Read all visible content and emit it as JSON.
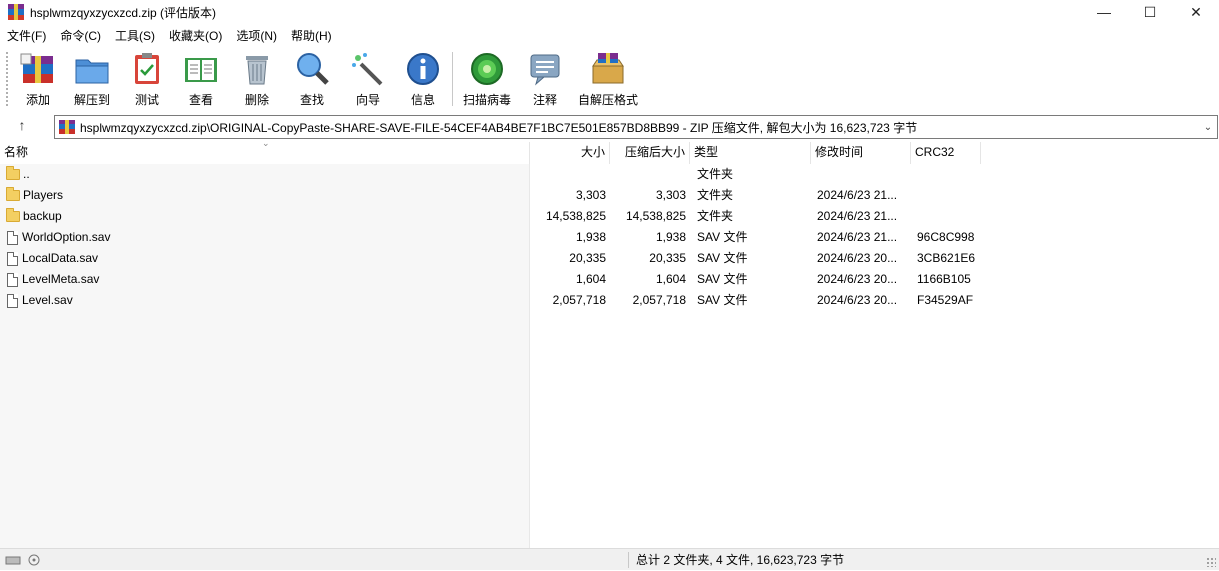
{
  "window": {
    "title": "hsplwmzqyxzycxzcd.zip (评估版本)",
    "minimize": "—",
    "maximize": "☐",
    "close": "✕"
  },
  "menu": [
    "文件(F)",
    "命令(C)",
    "工具(S)",
    "收藏夹(O)",
    "选项(N)",
    "帮助(H)"
  ],
  "toolbar": {
    "add": "添加",
    "extract": "解压到",
    "test": "测试",
    "view": "查看",
    "delete": "删除",
    "find": "查找",
    "wizard": "向导",
    "info": "信息",
    "virus": "扫描病毒",
    "comment": "注释",
    "sfx": "自解压格式"
  },
  "address": {
    "up": "↑",
    "path": "hsplwmzqyxzycxzcd.zip\\ORIGINAL-CopyPaste-SHARE-SAVE-FILE-54CEF4AB4BE7F1BC7E501E857BD8BB99 - ZIP 压缩文件, 解包大小为 16,623,723 字节",
    "dropdown": "⌄"
  },
  "columns": {
    "name": "名称",
    "size": "大小",
    "packed": "压缩后大小",
    "type": "类型",
    "modified": "修改时间",
    "crc": "CRC32"
  },
  "files": [
    {
      "name": "..",
      "size": "",
      "packed": "",
      "type": "文件夹",
      "modified": "",
      "crc": "",
      "kind": "folder"
    },
    {
      "name": "Players",
      "size": "3,303",
      "packed": "3,303",
      "type": "文件夹",
      "modified": "2024/6/23 21...",
      "crc": "",
      "kind": "folder"
    },
    {
      "name": "backup",
      "size": "14,538,825",
      "packed": "14,538,825",
      "type": "文件夹",
      "modified": "2024/6/23 21...",
      "crc": "",
      "kind": "folder"
    },
    {
      "name": "WorldOption.sav",
      "size": "1,938",
      "packed": "1,938",
      "type": "SAV 文件",
      "modified": "2024/6/23 21...",
      "crc": "96C8C998",
      "kind": "file"
    },
    {
      "name": "LocalData.sav",
      "size": "20,335",
      "packed": "20,335",
      "type": "SAV 文件",
      "modified": "2024/6/23 20...",
      "crc": "3CB621E6",
      "kind": "file"
    },
    {
      "name": "LevelMeta.sav",
      "size": "1,604",
      "packed": "1,604",
      "type": "SAV 文件",
      "modified": "2024/6/23 20...",
      "crc": "1166B105",
      "kind": "file"
    },
    {
      "name": "Level.sav",
      "size": "2,057,718",
      "packed": "2,057,718",
      "type": "SAV 文件",
      "modified": "2024/6/23 20...",
      "crc": "F34529AF",
      "kind": "file"
    }
  ],
  "status": {
    "summary": "总计 2 文件夹, 4 文件, 16,623,723 字节"
  }
}
